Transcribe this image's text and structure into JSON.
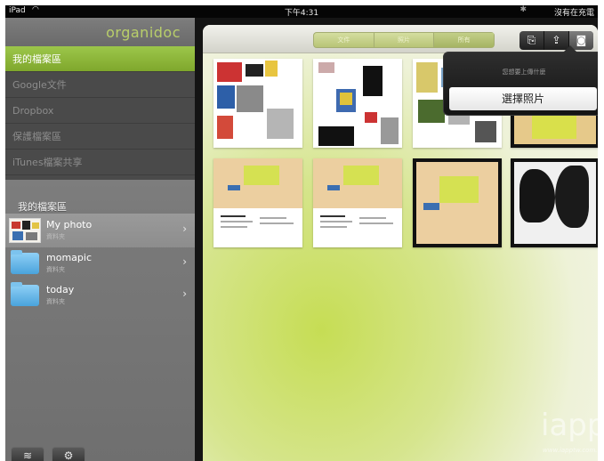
{
  "statusbar": {
    "carrier": "iPad",
    "time": "下午4:31",
    "battery": "沒有在充電"
  },
  "app": {
    "logo": "organidoc"
  },
  "menu": {
    "items": [
      {
        "label": "我的檔案區",
        "active": true
      },
      {
        "label": "Google文件",
        "active": false
      },
      {
        "label": "Dropbox",
        "active": false
      },
      {
        "label": "保護檔案區",
        "active": false
      },
      {
        "label": "iTunes檔案共享",
        "active": false
      }
    ]
  },
  "folders": {
    "section_title": "我的檔案區",
    "items": [
      {
        "name": "My photo",
        "subtitle": "資料夾"
      },
      {
        "name": "momapic",
        "subtitle": "資料夾"
      },
      {
        "name": "today",
        "subtitle": "資料夾"
      }
    ]
  },
  "toolbar": {
    "segments": [
      "文件",
      "照片",
      "所有"
    ],
    "icons": [
      "import-icon",
      "share-icon",
      "camera-icon"
    ]
  },
  "popover": {
    "title": "您想要上傳什麼",
    "button": "選擇照片"
  },
  "watermark": {
    "text": "iapp",
    "url": "www.iapptw.com.tw"
  },
  "colors": {
    "accent": "#8db63a",
    "sidebar": "#4a4a4a",
    "panel_green": "#c6dd54"
  }
}
